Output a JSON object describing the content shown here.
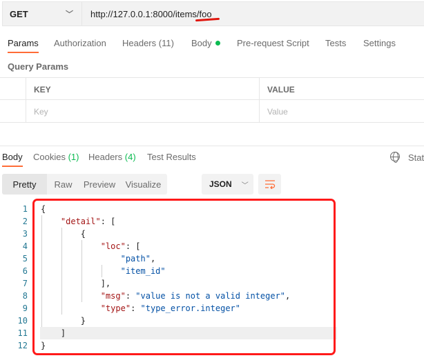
{
  "request": {
    "method": "GET",
    "url": "http://127.0.0.1:8000/items/foo"
  },
  "request_tabs": [
    {
      "label": "Params"
    },
    {
      "label": "Authorization"
    },
    {
      "label": "Headers (11)"
    },
    {
      "label": "Body"
    },
    {
      "label": "Pre-request Script"
    },
    {
      "label": "Tests"
    },
    {
      "label": "Settings"
    }
  ],
  "query_params": {
    "title": "Query Params",
    "headers": [
      "KEY",
      "VALUE"
    ],
    "key_placeholder": "Key",
    "value_placeholder": "Value"
  },
  "response_tabs": [
    {
      "label": "Body"
    },
    {
      "label": "Cookies",
      "count": "(1)"
    },
    {
      "label": "Headers",
      "count": "(4)"
    },
    {
      "label": "Test Results"
    }
  ],
  "status_label": "Stat",
  "format_tabs": [
    "Pretty",
    "Raw",
    "Preview",
    "Visualize"
  ],
  "format_select": "JSON",
  "colors": {
    "accent": "#ff6c37",
    "annotation": "#ff1a1a",
    "key": "#a31515",
    "string": "#0451a5"
  },
  "code": {
    "line_numbers": [
      "1",
      "2",
      "3",
      "4",
      "5",
      "6",
      "7",
      "8",
      "9",
      "10",
      "11",
      "12"
    ],
    "lines": [
      [
        {
          "t": "{",
          "c": ""
        }
      ],
      [
        {
          "t": "    ",
          "c": ""
        },
        {
          "t": "\"detail\"",
          "c": "k"
        },
        {
          "t": ": [",
          "c": ""
        }
      ],
      [
        {
          "t": "        {",
          "c": ""
        }
      ],
      [
        {
          "t": "            ",
          "c": ""
        },
        {
          "t": "\"loc\"",
          "c": "k"
        },
        {
          "t": ": [",
          "c": ""
        }
      ],
      [
        {
          "t": "                ",
          "c": ""
        },
        {
          "t": "\"path\"",
          "c": "s"
        },
        {
          "t": ",",
          "c": ""
        }
      ],
      [
        {
          "t": "                ",
          "c": ""
        },
        {
          "t": "\"item_id\"",
          "c": "s"
        }
      ],
      [
        {
          "t": "            ],",
          "c": ""
        }
      ],
      [
        {
          "t": "            ",
          "c": ""
        },
        {
          "t": "\"msg\"",
          "c": "k"
        },
        {
          "t": ": ",
          "c": ""
        },
        {
          "t": "\"value is not a valid integer\"",
          "c": "s"
        },
        {
          "t": ",",
          "c": ""
        }
      ],
      [
        {
          "t": "            ",
          "c": ""
        },
        {
          "t": "\"type\"",
          "c": "k"
        },
        {
          "t": ": ",
          "c": ""
        },
        {
          "t": "\"type_error.integer\"",
          "c": "s"
        }
      ],
      [
        {
          "t": "        }",
          "c": ""
        }
      ],
      [
        {
          "t": "    ]",
          "c": ""
        }
      ],
      [
        {
          "t": "}",
          "c": ""
        }
      ]
    ]
  }
}
